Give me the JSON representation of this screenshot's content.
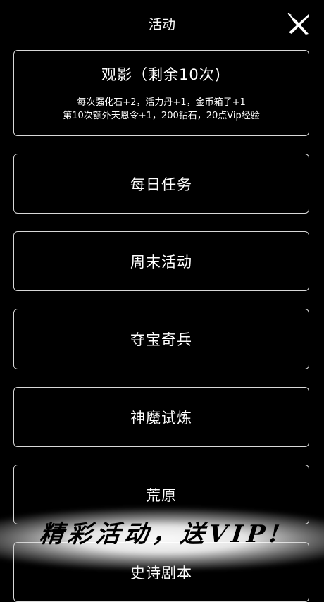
{
  "header": {
    "title": "活动"
  },
  "video_card": {
    "label": "观影（剩余10次)",
    "desc_line1": "每次强化石+2，活力丹+1，金币箱子+1",
    "desc_line2": "第10次额外天恩令+1，200钻石，20点Vip经验"
  },
  "menu": {
    "items": [
      {
        "label": "每日任务"
      },
      {
        "label": "周末活动"
      },
      {
        "label": "夺宝奇兵"
      },
      {
        "label": "神魔试炼"
      },
      {
        "label": "荒原"
      },
      {
        "label": "史诗剧本"
      }
    ]
  },
  "promo": {
    "text": "精彩活动，送VIP!"
  }
}
